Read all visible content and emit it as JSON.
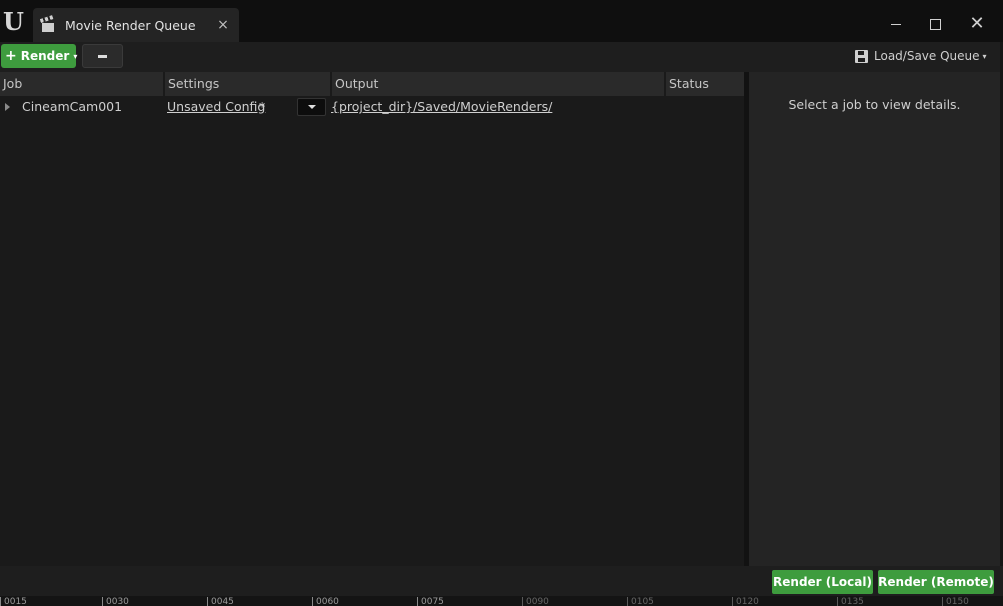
{
  "window": {
    "tab_title": "Movie Render Queue",
    "tab_close": "×",
    "close_glyph": "✕"
  },
  "toolbar": {
    "render_label": "Render",
    "render_plus": "+",
    "render_caret": "▾",
    "load_save_label": "Load/Save Queue",
    "load_save_caret": "▾"
  },
  "table": {
    "columns": [
      "Job",
      "Settings",
      "Output",
      "Status"
    ],
    "rows": [
      {
        "job": "CineamCam001",
        "settings": "Unsaved Config",
        "settings_dirty": "*",
        "output": "{project_dir}/Saved/MovieRenders/",
        "status": ""
      }
    ]
  },
  "details": {
    "empty_message": "Select a job to view details."
  },
  "footer": {
    "render_local_label": "Render (Local)",
    "render_remote_label": "Render (Remote)"
  },
  "timeline": {
    "ticks": [
      "0015",
      "0030",
      "0045",
      "0060",
      "0075",
      "0090",
      "0105",
      "0120",
      "0135",
      "0150"
    ]
  },
  "colors": {
    "accent_green": "#3e9c3e",
    "background": "#1a1a1a",
    "panel": "#242424"
  }
}
